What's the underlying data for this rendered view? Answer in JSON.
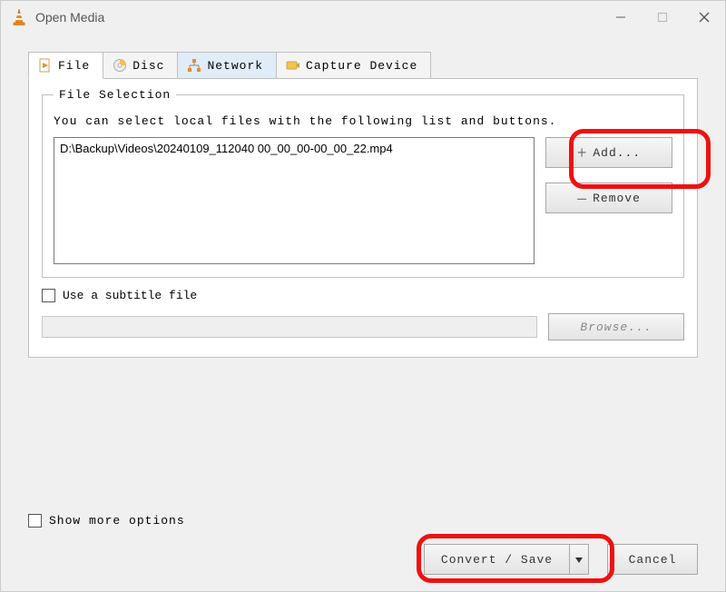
{
  "window": {
    "title": "Open Media"
  },
  "tabs": {
    "file": "File",
    "disc": "Disc",
    "network": "Network",
    "capture": "Capture Device"
  },
  "file_section": {
    "legend": "File Selection",
    "hint": "You can select local files with the following list and buttons.",
    "selected_file": "D:\\Backup\\Videos\\20240109_112040 00_00_00-00_00_22.mp4",
    "add_label": "Add...",
    "remove_label": "Remove"
  },
  "subtitle": {
    "checkbox_label": "Use a subtitle file",
    "browse_label": "Browse..."
  },
  "footer": {
    "show_more": "Show more options",
    "convert": "Convert / Save",
    "cancel": "Cancel"
  }
}
